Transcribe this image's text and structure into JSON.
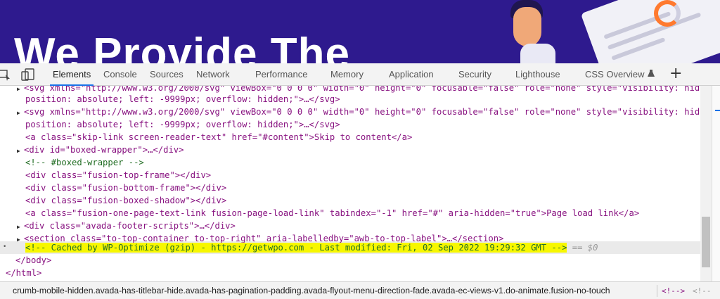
{
  "hero": {
    "title": "We Provide The",
    "bg_color": "#2e1a8e",
    "accent_color": "#ff7a2f"
  },
  "toolbar": {
    "tabs": [
      {
        "label": "Elements",
        "active": true
      },
      {
        "label": "Console"
      },
      {
        "label": "Sources"
      },
      {
        "label": "Network"
      },
      {
        "label": "Performance"
      },
      {
        "label": "Memory"
      },
      {
        "label": "Application"
      },
      {
        "label": "Security"
      },
      {
        "label": "Lighthouse"
      },
      {
        "label": "CSS Overview"
      }
    ],
    "icons": [
      "inspect-cursor-icon",
      "device-toggle-icon",
      "flask-icon",
      "plus-icon"
    ],
    "plus": "+",
    "accent_color": "#1a73e8"
  },
  "elements": {
    "lines": [
      "<svg xmlns=\"http://www.w3.org/2000/svg\" viewBox=\"0 0 0 0\" width=\"0\" height=\"0\" focusable=\"false\" role=\"none\" style=\"visibility: hidden;",
      "position: absolute; left: -9999px; overflow: hidden;\">…</svg>",
      "<svg xmlns=\"http://www.w3.org/2000/svg\" viewBox=\"0 0 0 0\" width=\"0\" height=\"0\" focusable=\"false\" role=\"none\" style=\"visibility: hidden;",
      "position: absolute; left: -9999px; overflow: hidden;\">…</svg>",
      "<a class=\"skip-link screen-reader-text\" href=\"#content\">Skip to content</a>",
      "<div id=\"boxed-wrapper\">…</div>",
      "<!-- #boxed-wrapper -->",
      "<div class=\"fusion-top-frame\"></div>",
      "<div class=\"fusion-bottom-frame\"></div>",
      "<div class=\"fusion-boxed-shadow\"></div>",
      "<a class=\"fusion-one-page-text-link fusion-page-load-link\" tabindex=\"-1\" href=\"#\" aria-hidden=\"true\">Page load link</a>",
      "<div class=\"avada-footer-scripts\">…</div>",
      "<section class=\"to-top-container to-top-right\" aria-labelledby=\"awb-to-top-label\">…</section>",
      "<!-- Cached by WP-Optimize (gzip) - https://getwpo.com - Last modified: Fri, 02 Sep 2022 19:29:32 GMT -->",
      "== $0",
      "</body>",
      "</html>"
    ],
    "highlight_color": "#f7f700",
    "selected_marker": "•"
  },
  "breadcrumb": {
    "path": "crumb-mobile-hidden.avada-has-titlebar-hide.avada-has-pagination-padding.avada-flyout-menu-direction-fade.avada-ec-views-v1.do-animate.fusion-no-touch",
    "selected": "<!-->",
    "more": "<!--"
  }
}
